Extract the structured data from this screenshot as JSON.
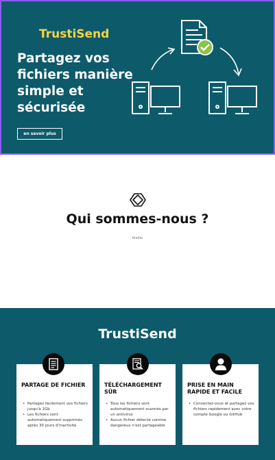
{
  "hero": {
    "brand": "TrustiSend",
    "title": "Partagez vos fichiers manière simple et sécurisée",
    "button_label": "en savoir plus",
    "colors": {
      "background": "#0d5a6a",
      "brand": "#f5d445",
      "check": "#8bc34a"
    }
  },
  "about": {
    "title": "Qui sommes-nous ?",
    "subtitle": "blabla"
  },
  "features": {
    "title": "TrustiSend",
    "cards": [
      {
        "icon": "file-list-icon",
        "heading": "PARTAGE DE FICHIER",
        "bullets": [
          "Partagez facilement vos fichiers jusqu'à 1Gb",
          "Les fichiers sont automatiquement supprimés après 30 jours d'inactivité"
        ]
      },
      {
        "icon": "scan-document-icon",
        "heading": "TÉLÉCHARGEMENT SÛR",
        "bullets": [
          "Tous les fichiers sont automatiquement scannés par un antivirus",
          "Aucun fichier détecté comme dangereux n'est partageable"
        ]
      },
      {
        "icon": "user-icon",
        "heading": "PRISE EN MAIN RAPIDE ET FACILE",
        "bullets": [
          "Connectez-vous et partagez vos fichiers rapidement avec votre compte Google ou GitHub"
        ]
      }
    ]
  }
}
